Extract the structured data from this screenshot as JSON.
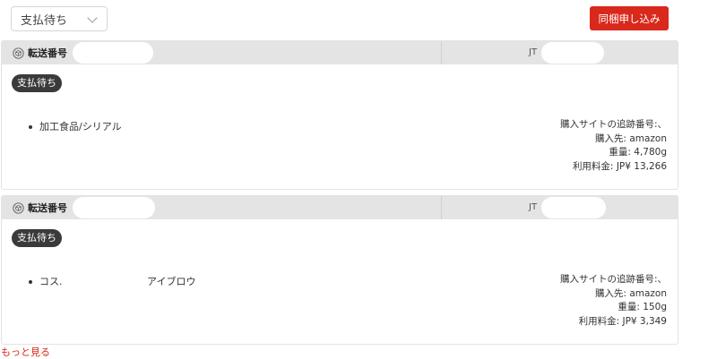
{
  "toolbar": {
    "status_filter": "支払待ち",
    "bundle_button": "同梱申し込み"
  },
  "shipments": [
    {
      "header_label": "転送番号",
      "tracking_prefix": "JT",
      "status_badge": "支払待ち",
      "item_text": "加工食品/シリアル",
      "item_extra": "",
      "tracking_label": "購入サイトの追跡番号:、",
      "source": "購入先: amazon",
      "weight": "重量: 4,780g",
      "fee": "利用料金: JP¥ 13,266"
    },
    {
      "header_label": "転送番号",
      "tracking_prefix": "JT",
      "status_badge": "支払待ち",
      "item_text": "コス.",
      "item_extra": "アイブロウ",
      "tracking_label": "購入サイトの追跡番号:、",
      "source": "購入先: amazon",
      "weight": "重量: 150g",
      "fee": "利用料金: JP¥ 3,349"
    }
  ],
  "footer": {
    "more_link": "もっと見る"
  },
  "colors": {
    "accent": "#d9291c",
    "badge": "#3a3a3a",
    "header_bg": "#e4e4e4"
  }
}
